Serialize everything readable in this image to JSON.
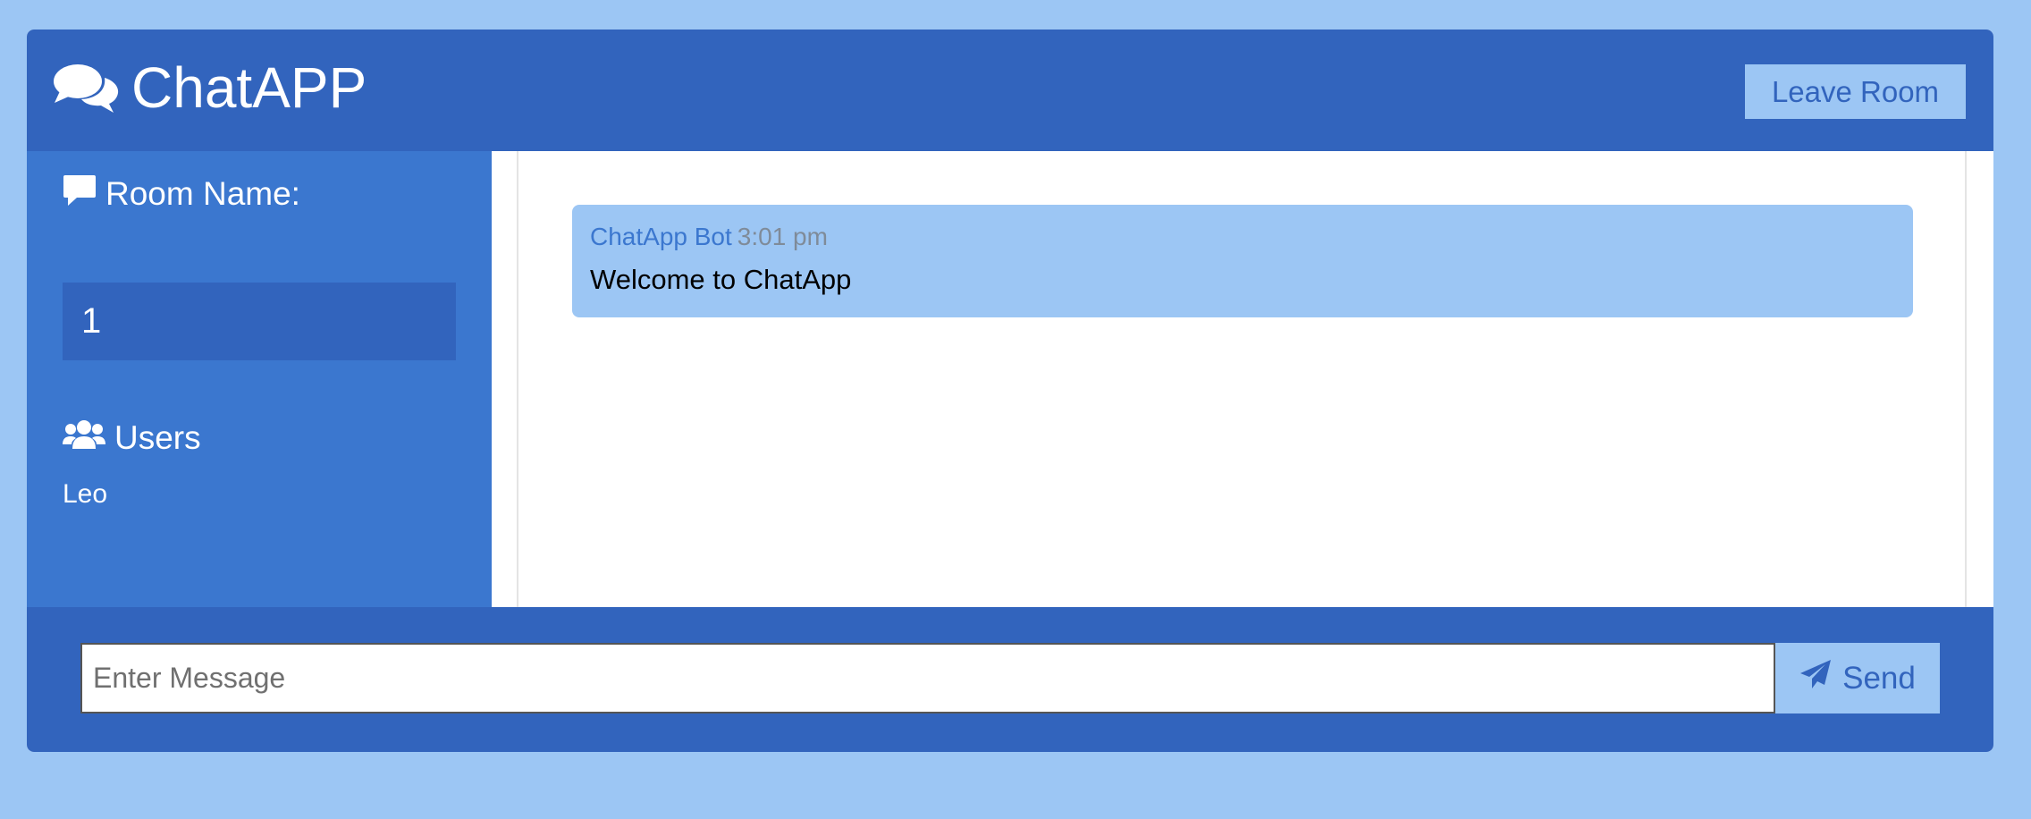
{
  "header": {
    "title": "ChatAPP",
    "brand_icon": "comments-icon",
    "leave_label": "Leave Room"
  },
  "sidebar": {
    "room_heading": "Room Name:",
    "room_icon": "comment-icon",
    "room_name": "1",
    "users_heading": "Users",
    "users_icon": "users-icon",
    "users": [
      "Leo"
    ]
  },
  "messages": [
    {
      "author": "ChatApp Bot",
      "time": "3:01 pm",
      "text": "Welcome to ChatApp"
    }
  ],
  "composer": {
    "placeholder": "Enter Message",
    "value": "",
    "send_label": "Send",
    "send_icon": "paper-plane-icon"
  },
  "colors": {
    "page_bg": "#9cc6f4",
    "header_bg": "#3264bd",
    "sidebar_bg": "#3b77cf",
    "accent_light": "#9cc6f4"
  }
}
